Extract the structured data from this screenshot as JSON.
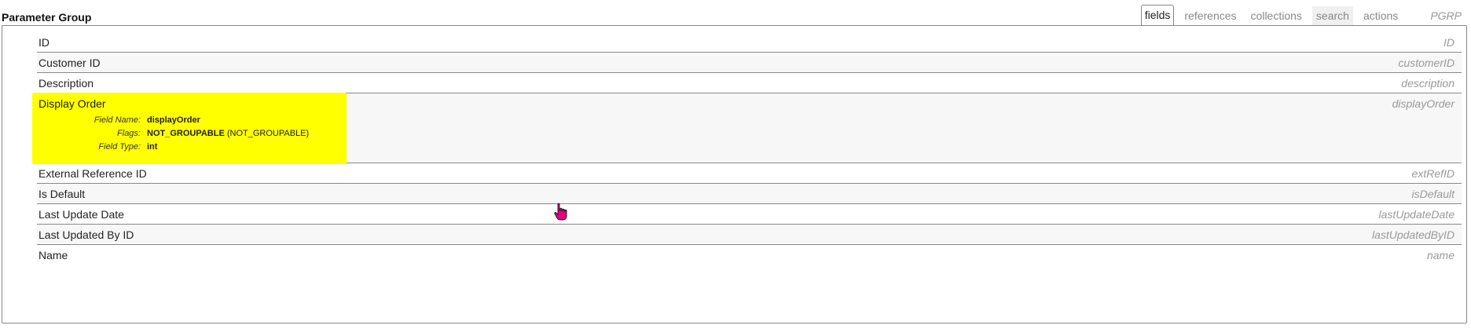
{
  "header": {
    "title": "Parameter Group",
    "tabs": [
      {
        "label": "fields",
        "active": true
      },
      {
        "label": "references",
        "active": false
      },
      {
        "label": "collections",
        "active": false
      },
      {
        "label": "search",
        "active": false
      },
      {
        "label": "actions",
        "active": false
      }
    ],
    "code": "PGRP"
  },
  "fields": [
    {
      "label": "ID",
      "code": "ID"
    },
    {
      "label": "Customer ID",
      "code": "customerID"
    },
    {
      "label": "Description",
      "code": "description"
    },
    {
      "label": "Display Order",
      "code": "displayOrder",
      "details": {
        "field_name_key": "Field Name:",
        "field_name_value": "displayOrder",
        "flags_key": "Flags:",
        "flags_value": "NOT_GROUPABLE",
        "flags_extra": "(NOT_GROUPABLE)",
        "field_type_key": "Field Type:",
        "field_type_value": "int"
      }
    },
    {
      "label": "External Reference ID",
      "code": "extRefID"
    },
    {
      "label": "Is Default",
      "code": "isDefault"
    },
    {
      "label": "Last Update Date",
      "code": "lastUpdateDate"
    },
    {
      "label": "Last Updated By ID",
      "code": "lastUpdatedByID"
    },
    {
      "label": "Name",
      "code": "name"
    }
  ],
  "colors": {
    "highlight": "#ffff00",
    "cursor": "#e6007e"
  },
  "icons": {
    "cursor": "hand-pointer-icon"
  }
}
